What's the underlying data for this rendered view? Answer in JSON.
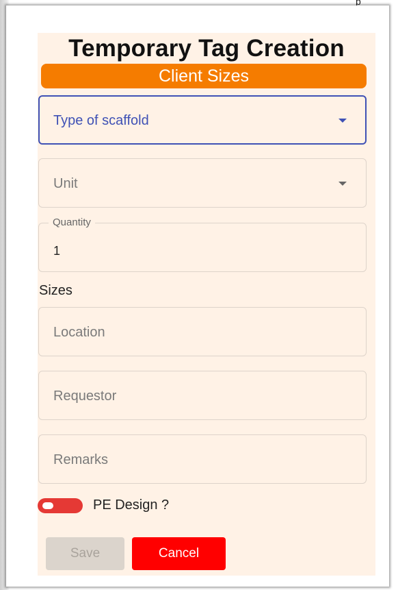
{
  "top_fragment": "p",
  "dialog": {
    "title": "Temporary Tag Creation",
    "banner": "Client Sizes",
    "fields": {
      "type_of_scaffold": {
        "placeholder": "Type of scaffold"
      },
      "unit": {
        "placeholder": "Unit"
      },
      "quantity": {
        "label": "Quantity",
        "value": "1"
      },
      "sizes_label": "Sizes",
      "location": {
        "placeholder": "Location"
      },
      "requestor": {
        "placeholder": "Requestor"
      },
      "remarks": {
        "placeholder": "Remarks"
      }
    },
    "pe_design": {
      "label": "PE Design ?",
      "checked": false
    },
    "buttons": {
      "save": "Save",
      "cancel": "Cancel"
    },
    "colors": {
      "banner": "#f57c00",
      "focus": "#3f51b5",
      "cancel": "#ff0000",
      "panel": "#fff2e6",
      "toggle": "#e53935"
    }
  }
}
